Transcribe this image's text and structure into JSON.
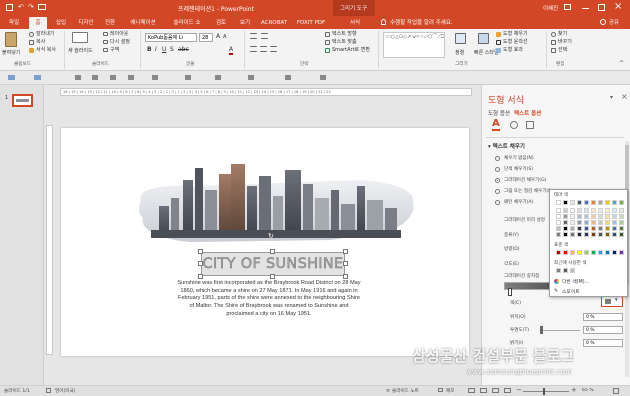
{
  "window": {
    "title": "프레젠테이션1 - PowerPoint",
    "context_tab": "그리기 도구",
    "user": "이혜진",
    "share": "공유"
  },
  "tabs": [
    "파일",
    "홈",
    "삽입",
    "디자인",
    "전환",
    "애니메이션",
    "슬라이드 쇼",
    "검토",
    "보기",
    "ACROBAT",
    "FOXIT PDF",
    "서식"
  ],
  "tell_me": "수행할 작업을 알려 주세요.",
  "ribbon": {
    "paste": "붙여넣기",
    "cut": "잘라내기",
    "copy": "복사",
    "format_painter": "서식 복사",
    "new_slide": "새 슬라이드",
    "layout": "레이아웃",
    "reset": "다시 설정",
    "section": "구역",
    "font_name": "KoPub돋움체 Li",
    "font_size": "28",
    "shape_fill": "도형 채우기",
    "shape_outline": "도형 윤곽선",
    "shape_effects": "도형 효과",
    "text_direction": "텍스트 방향",
    "align_text": "텍스트 맞춤",
    "smartart": "SmartArt로 변환",
    "arrange": "정렬",
    "quick_styles": "빠른 스타일",
    "find": "찾기",
    "replace": "바꾸기",
    "select": "선택",
    "groups": [
      "클립보드",
      "슬라이드",
      "글꼴",
      "단락",
      "그리기",
      "편집"
    ]
  },
  "ruler": "16 | 15 | 14 | 13 | 12 | 11 | 10 | 9 | 8 | 7 | 6 | 5 | 4 | 3 | 2 | 1 | 0 | 1 | 2 | 3 | 4 | 5 | 6 | 7 | 8 | 9 | 10 | 11 | 12 | 13 | 14 | 15 | 16 | 17 | 18 | 19 | 20 | 21 | 22",
  "slide": {
    "number": "1",
    "title": "CITY OF SUNSHINE",
    "body": [
      "Sunshine was first incorporated as the Braybrook Road District on 28 May",
      "1860, which became a shire on 27 May 1871. In May 1916 and again in",
      "February 1951, parts of the shire were annexed to the neighbouring Shire",
      "of Maltor. The Shire of Braybrook was renamed to Sunshine and",
      "proclaimed a city on 16 May 1951."
    ]
  },
  "pane": {
    "title": "도형 서식",
    "tab_shape": "도형 옵션",
    "tab_text": "텍스트 옵션",
    "section": "텍스트 채우기",
    "options": [
      "채우기 없음(N)",
      "단색 채우기(S)",
      "그라데이션 채우기(G)",
      "그림 또는 질감 채우기(P)",
      "패턴 채우기(A)"
    ],
    "selected_option": 2,
    "labels": [
      "그라데이션 미리 설정",
      "종류(Y)",
      "방향(D)",
      "각도(E)",
      "그라데이션 중지점"
    ],
    "color_label": "색(C)",
    "position_label": "위치(O)",
    "transparency_label": "투명도(T)",
    "brightness_label": "밝기(I)",
    "position_value": "0 %",
    "transparency_value": "0 %",
    "brightness_value": "0 %"
  },
  "palette": {
    "theme_label": "테마 색",
    "standard_label": "표준 색",
    "recent_label": "최근에 사용한 색",
    "more_colors": "다른 색(M)...",
    "eyedropper": "스포이트",
    "theme_top": [
      "#ffffff",
      "#000000",
      "#e7e6e6",
      "#44546a",
      "#4472c4",
      "#ed7d31",
      "#a5a5a5",
      "#ffc000",
      "#5b9bd5",
      "#70ad47"
    ],
    "standard": [
      "#c00000",
      "#ff0000",
      "#ffc000",
      "#ffff00",
      "#92d050",
      "#00b050",
      "#00b0f0",
      "#0070c0",
      "#002060",
      "#7030a0"
    ],
    "recent": [
      "#7f7f7f",
      "#595959",
      "#bfbfbf"
    ]
  },
  "status": {
    "slide": "슬라이드 1/1",
    "language": "영어(미국)",
    "notes": "슬라이드 노트",
    "comments": "메모",
    "zoom": "65 %"
  },
  "watermark": {
    "title": "삼성물산 건설부문 블로그",
    "url": "www.samsungblueprint.com"
  }
}
